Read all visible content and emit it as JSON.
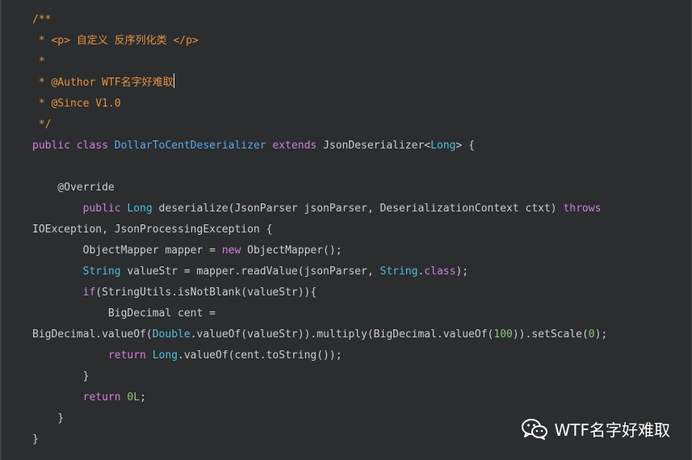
{
  "code": {
    "lines": [
      [
        {
          "t": "/**",
          "c": "comment"
        }
      ],
      [
        {
          "t": " * <p> 自定义 反序列化类 </p>",
          "c": "comment"
        }
      ],
      [
        {
          "t": " *",
          "c": "comment"
        }
      ],
      [
        {
          "t": " * @Author WTF名字好难取",
          "c": "comment"
        }
      ],
      [
        {
          "t": " * @Since V1.0",
          "c": "comment"
        }
      ],
      [
        {
          "t": " */",
          "c": "comment"
        }
      ],
      [
        {
          "t": "public ",
          "c": "kw"
        },
        {
          "t": "class ",
          "c": "kw"
        },
        {
          "t": "DollarToCentDeserializer",
          "c": "class"
        },
        {
          "t": " extends ",
          "c": "kw"
        },
        {
          "t": "JsonDeserializer<",
          "c": "plain"
        },
        {
          "t": "Long",
          "c": "type"
        },
        {
          "t": "> {",
          "c": "plain"
        }
      ],
      [
        {
          "t": "",
          "c": "plain"
        }
      ],
      [
        {
          "t": "    @Override",
          "c": "ann"
        }
      ],
      [
        {
          "t": "        public ",
          "c": "kw"
        },
        {
          "t": "Long",
          "c": "type"
        },
        {
          "t": " deserialize(JsonParser jsonParser, DeserializationContext ctxt) ",
          "c": "plain"
        },
        {
          "t": "throws",
          "c": "kw"
        }
      ],
      [
        {
          "t": "IOException, JsonProcessingException {",
          "c": "plain"
        }
      ],
      [
        {
          "t": "        ObjectMapper mapper = ",
          "c": "plain"
        },
        {
          "t": "new ",
          "c": "kw"
        },
        {
          "t": "ObjectMapper();",
          "c": "plain"
        }
      ],
      [
        {
          "t": "        ",
          "c": "plain"
        },
        {
          "t": "String",
          "c": "type"
        },
        {
          "t": " valueStr = mapper.readValue(jsonParser, ",
          "c": "plain"
        },
        {
          "t": "String",
          "c": "type"
        },
        {
          "t": ".",
          "c": "plain"
        },
        {
          "t": "class",
          "c": "kw"
        },
        {
          "t": ");",
          "c": "plain"
        }
      ],
      [
        {
          "t": "        ",
          "c": "plain"
        },
        {
          "t": "if",
          "c": "kw"
        },
        {
          "t": "(StringUtils.isNotBlank(valueStr)){",
          "c": "plain"
        }
      ],
      [
        {
          "t": "            BigDecimal cent =",
          "c": "plain"
        }
      ],
      [
        {
          "t": "BigDecimal.valueOf(",
          "c": "plain"
        },
        {
          "t": "Double",
          "c": "type"
        },
        {
          "t": ".valueOf(valueStr)).multiply(BigDecimal.valueOf(",
          "c": "plain"
        },
        {
          "t": "100",
          "c": "num"
        },
        {
          "t": ")).setScale(",
          "c": "plain"
        },
        {
          "t": "0",
          "c": "num"
        },
        {
          "t": ");",
          "c": "plain"
        }
      ],
      [
        {
          "t": "            ",
          "c": "plain"
        },
        {
          "t": "return ",
          "c": "kw"
        },
        {
          "t": "Long",
          "c": "type"
        },
        {
          "t": ".valueOf(cent.toString());",
          "c": "plain"
        }
      ],
      [
        {
          "t": "        }",
          "c": "plain"
        }
      ],
      [
        {
          "t": "        ",
          "c": "plain"
        },
        {
          "t": "return ",
          "c": "kw"
        },
        {
          "t": "0L",
          "c": "num"
        },
        {
          "t": ";",
          "c": "plain"
        }
      ],
      [
        {
          "t": "    }",
          "c": "plain"
        }
      ],
      [
        {
          "t": "}",
          "c": "plain"
        }
      ]
    ]
  },
  "watermark": {
    "text": "WTF名字好难取",
    "icon": "wechat-icon"
  },
  "colors": {
    "background": "#2b2d2f",
    "comment": "#e6913e",
    "keyword": "#cf7fdd",
    "type": "#4fbde0",
    "class_name": "#5aa8ee",
    "number": "#8cc57a",
    "text": "#c9ccd1"
  }
}
